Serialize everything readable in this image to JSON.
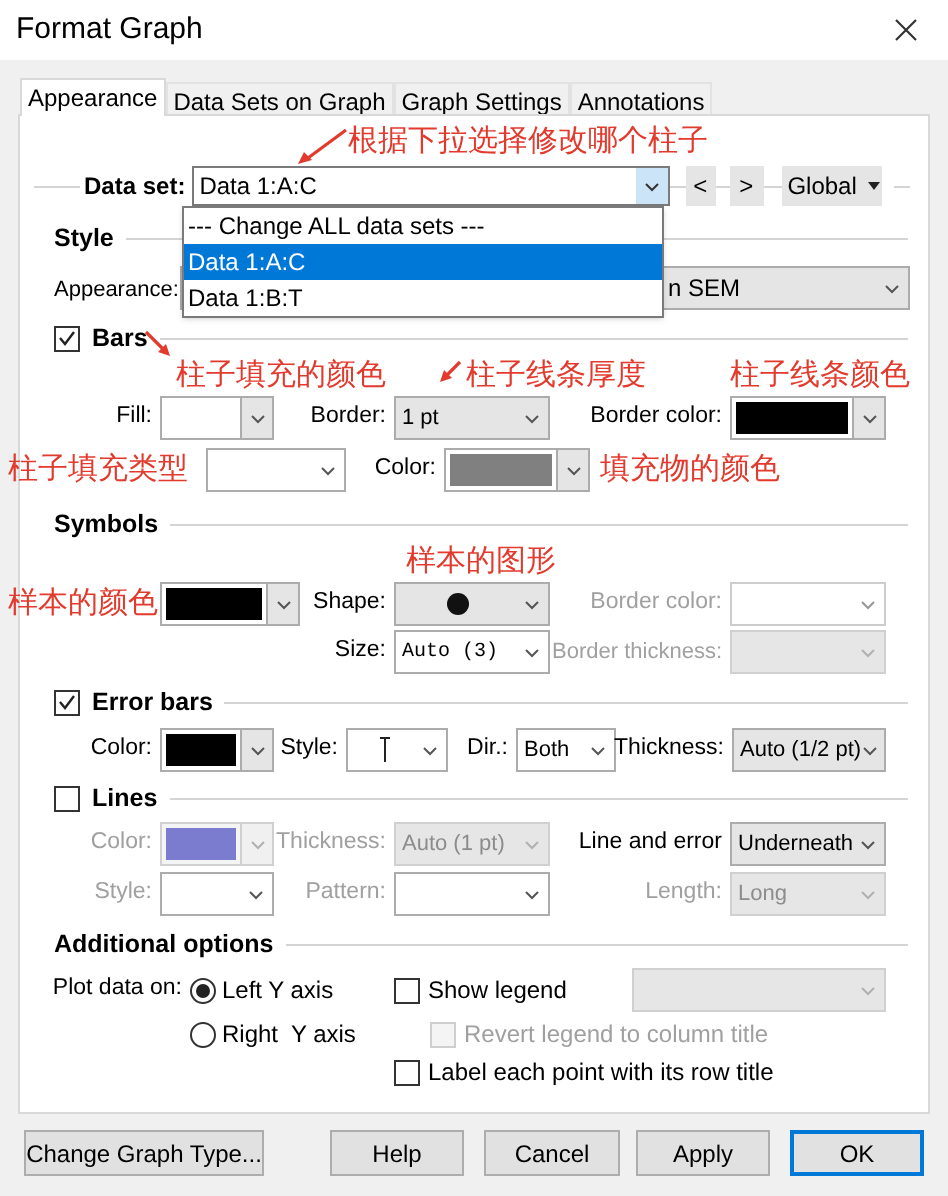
{
  "window": {
    "title": "Format Graph"
  },
  "tabs": [
    {
      "label": "Appearance",
      "selected": true
    },
    {
      "label": "Data Sets on Graph",
      "selected": false
    },
    {
      "label": "Graph Settings",
      "selected": false
    },
    {
      "label": "Annotations",
      "selected": false
    }
  ],
  "data_set": {
    "label": "Data set:",
    "value": "Data 1:A:C",
    "prev": "<",
    "next": ">",
    "scope": "Global"
  },
  "data_set_list": [
    {
      "label": "--- Change ALL data sets ---",
      "selected": false
    },
    {
      "label": "Data 1:A:C",
      "selected": true
    },
    {
      "label": "Data 1:B:T",
      "selected": false
    }
  ],
  "style": {
    "heading": "Style",
    "appearance_label": "Appearance:",
    "appearance_value": "n SEM"
  },
  "bars": {
    "label": "Bars",
    "checked": true,
    "fill_label": "Fill:",
    "border_label": "Border:",
    "border_value": "1 pt",
    "border_color_label": "Border color:",
    "pattern_color_label": "Color:"
  },
  "symbols": {
    "heading": "Symbols",
    "shape_label": "Shape:",
    "border_color_label": "Border color:",
    "border_disabled": true,
    "size_label": "Size:",
    "size_value": "Auto (3)",
    "border_thickness_label": "Border thickness:"
  },
  "error_bars": {
    "label": "Error bars",
    "checked": true,
    "color_label": "Color:",
    "style_label": "Style:",
    "dir_label": "Dir.:",
    "dir_value": "Both",
    "thickness_label": "Thickness:",
    "thickness_value": "Auto (1/2 pt)"
  },
  "lines": {
    "label": "Lines",
    "checked": false,
    "color_label": "Color:",
    "thickness_label": "Thickness:",
    "thickness_value": "Auto (1 pt)",
    "line_and_error_label": "Line and error",
    "line_and_error_value": "Underneath",
    "style_label": "Style:",
    "pattern_label": "Pattern:",
    "length_label": "Length:",
    "length_value": "Long"
  },
  "additional": {
    "heading": "Additional options",
    "plot_label": "Plot data on:",
    "axes": [
      {
        "label": "Left Y axis",
        "selected": true
      },
      {
        "label": "Right  Y axis",
        "selected": false
      }
    ],
    "show_legend": {
      "label": "Show legend",
      "checked": false
    },
    "revert_legend": {
      "label": "Revert legend to column title",
      "checked": false,
      "disabled": true
    },
    "label_points": {
      "label": "Label each point with its row title",
      "checked": false
    }
  },
  "buttons": [
    {
      "label": "Change Graph Type...",
      "default": false
    },
    {
      "label": "Help",
      "default": false
    },
    {
      "label": "Cancel",
      "default": false
    },
    {
      "label": "Apply",
      "default": false
    },
    {
      "label": "OK",
      "default": true
    }
  ],
  "annotations": [
    {
      "text": "根据下拉选择修改哪个柱子",
      "arrow": true
    },
    {
      "text": "柱子填充的颜色",
      "arrow": true
    },
    {
      "text": "柱子线条厚度",
      "arrow": true
    },
    {
      "text": "柱子线条颜色",
      "arrow": false
    },
    {
      "text": "柱子填充类型",
      "arrow": false
    },
    {
      "text": "填充物的颜色",
      "arrow": false
    },
    {
      "text": "样本的颜色",
      "arrow": false
    },
    {
      "text": "样本的图形",
      "arrow": false
    }
  ]
}
